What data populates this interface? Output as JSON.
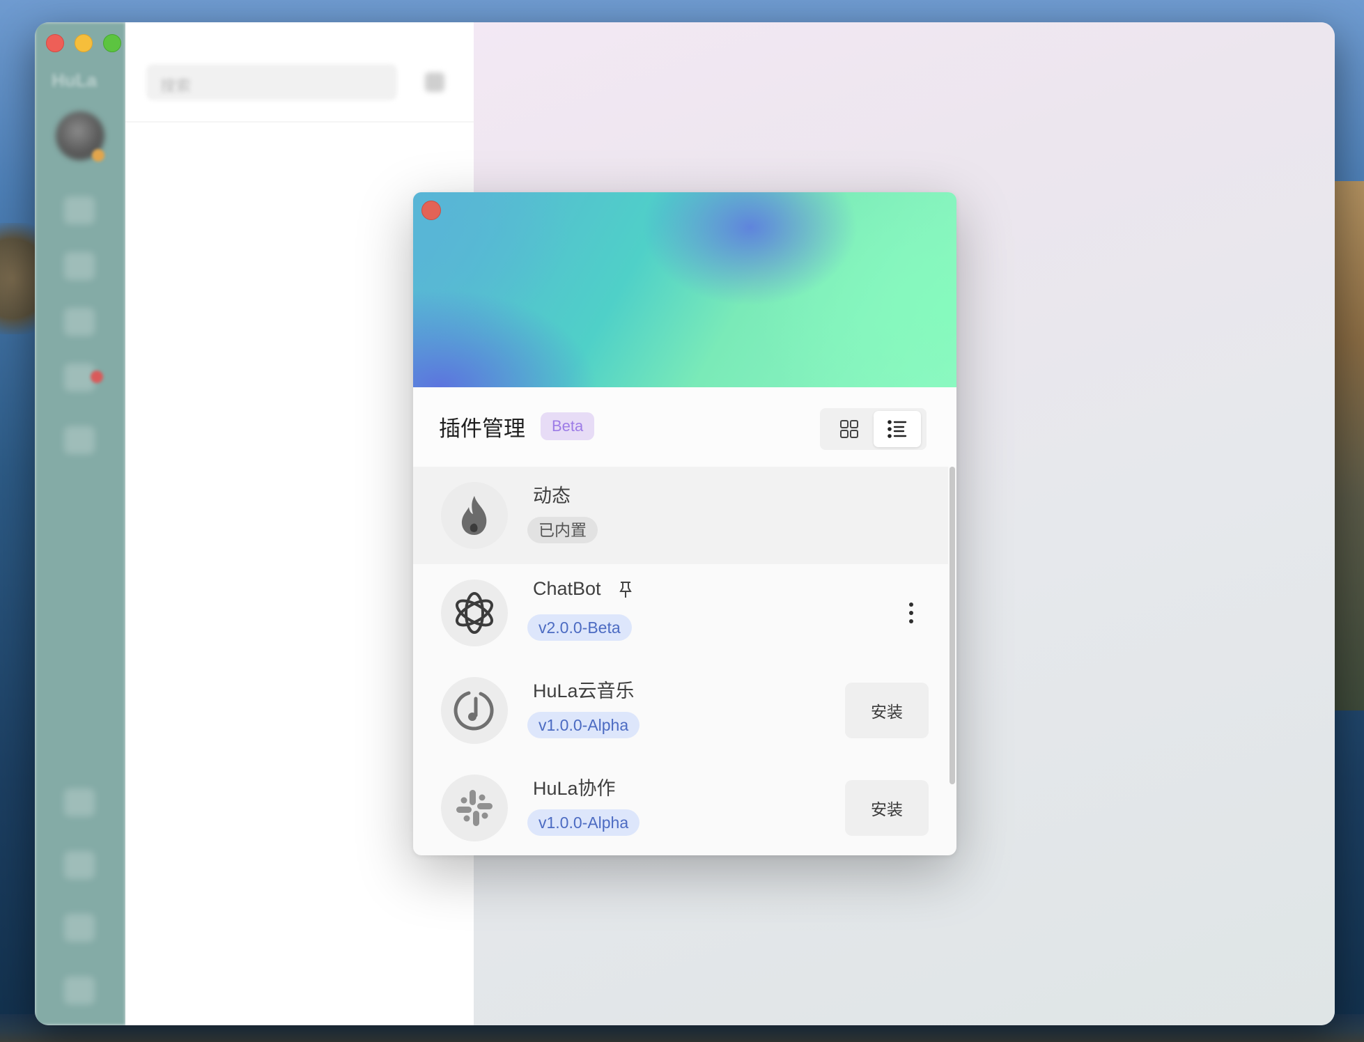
{
  "app": {
    "sidebar_name": "HuLa"
  },
  "list_panel": {
    "search_placeholder": "搜索"
  },
  "plugin_modal": {
    "title": "插件管理",
    "badge": "Beta",
    "plugins": [
      {
        "name": "动态",
        "tag": "已内置",
        "tag_style": "gray",
        "icon": "flame-icon",
        "action": "none"
      },
      {
        "name": "ChatBot",
        "tag": "v2.0.0-Beta",
        "tag_style": "blue",
        "icon": "openai-icon",
        "action": "more",
        "pinned": true
      },
      {
        "name": "HuLa云音乐",
        "tag": "v1.0.0-Alpha",
        "tag_style": "blue",
        "icon": "music-icon",
        "action": "install",
        "action_label": "安装"
      },
      {
        "name": "HuLa协作",
        "tag": "v1.0.0-Alpha",
        "tag_style": "blue",
        "icon": "slack-icon",
        "action": "install",
        "action_label": "安装"
      }
    ]
  },
  "colors": {
    "badge_bg": "#e7dcf6",
    "badge_text": "#9d7ce6",
    "version_tag_bg": "#dde6fb",
    "version_tag_text": "#4c6bc2",
    "sidebar": "#84aba6"
  }
}
